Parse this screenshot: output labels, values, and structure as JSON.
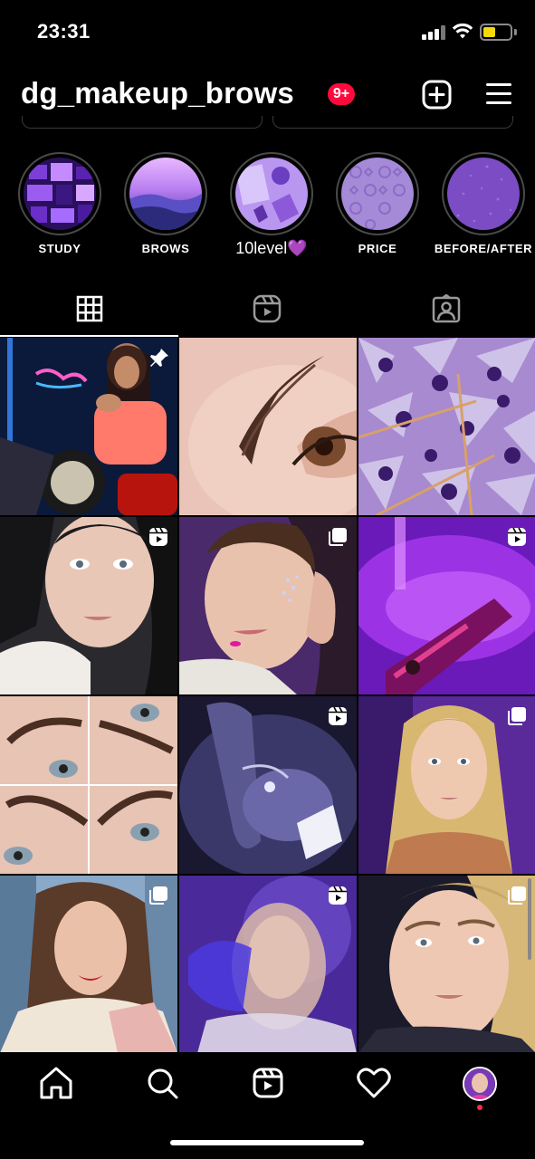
{
  "status_bar": {
    "time": "23:31",
    "battery_color": "#f5d90a"
  },
  "header": {
    "username": "dg_makeup_brows",
    "notification_badge": "9+",
    "badge_color": "#ff0a3c",
    "icons": [
      "add-square-icon",
      "hamburger-menu-icon"
    ]
  },
  "highlights": [
    {
      "label": "STUDY"
    },
    {
      "label": "BROWS"
    },
    {
      "label": "10level💜"
    },
    {
      "label": "PRICE"
    },
    {
      "label": "BEFORE/AFTER"
    }
  ],
  "tabs": [
    {
      "name": "posts-grid",
      "icon": "grid-icon",
      "active": true
    },
    {
      "name": "reels",
      "icon": "reels-icon",
      "active": false
    },
    {
      "name": "tagged",
      "icon": "tagged-person-icon",
      "active": false
    }
  ],
  "posts": [
    {
      "badge": "pin-icon"
    },
    {
      "badge": ""
    },
    {
      "badge": ""
    },
    {
      "badge": "reels-icon"
    },
    {
      "badge": "carousel-icon"
    },
    {
      "badge": "reels-icon"
    },
    {
      "badge": ""
    },
    {
      "badge": "reels-icon"
    },
    {
      "badge": "carousel-icon"
    },
    {
      "badge": "carousel-icon"
    },
    {
      "badge": "reels-icon"
    },
    {
      "badge": "carousel-icon"
    }
  ],
  "bottom_nav": {
    "items": [
      "home-icon",
      "search-icon",
      "reels-icon",
      "heart-icon",
      "profile-avatar"
    ],
    "notification_dot_color": "#ff2d3d"
  }
}
